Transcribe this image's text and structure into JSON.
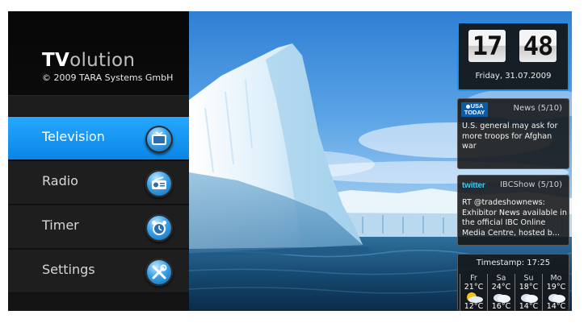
{
  "app": {
    "title_bold": "TV",
    "title_rest": "olution",
    "copyright": "© 2009 TARA Systems GmbH"
  },
  "menu": {
    "items": [
      {
        "label": "Television",
        "icon": "tv-icon",
        "active": true
      },
      {
        "label": "Radio",
        "icon": "radio-icon",
        "active": false
      },
      {
        "label": "Timer",
        "icon": "alarm-clock-icon",
        "active": false
      },
      {
        "label": "Settings",
        "icon": "tools-icon",
        "active": false
      }
    ]
  },
  "clock": {
    "hours": "17",
    "minutes": "48",
    "date": "Friday, 31.07.2009"
  },
  "news": {
    "logo_line1": "USA",
    "logo_line2": "TODAY",
    "source": "News (5/10)",
    "text": "U.S. general may ask for more troops for Afghan war"
  },
  "twitter": {
    "logo": "twitter",
    "source": "IBCShow (5/10)",
    "text": "RT @tradeshownews: Exhibitor News available in the official IBC Online Media Centre, hosted b..."
  },
  "weather": {
    "timestamp": "Timestamp: 17:25",
    "days": [
      {
        "day": "Fr",
        "high": "21°C",
        "low": "12°C",
        "icon": "partly-sunny-icon"
      },
      {
        "day": "Sa",
        "high": "24°C",
        "low": "16°C",
        "icon": "cloudy-icon"
      },
      {
        "day": "Su",
        "high": "18°C",
        "low": "14°C",
        "icon": "cloudy-icon"
      },
      {
        "day": "Mo",
        "high": "19°C",
        "low": "14°C",
        "icon": "cloudy-icon"
      }
    ]
  },
  "colors": {
    "accent": "#1e8fe8",
    "menu_active": "#0a86e6",
    "menu_bg": "#1e1e1e"
  }
}
